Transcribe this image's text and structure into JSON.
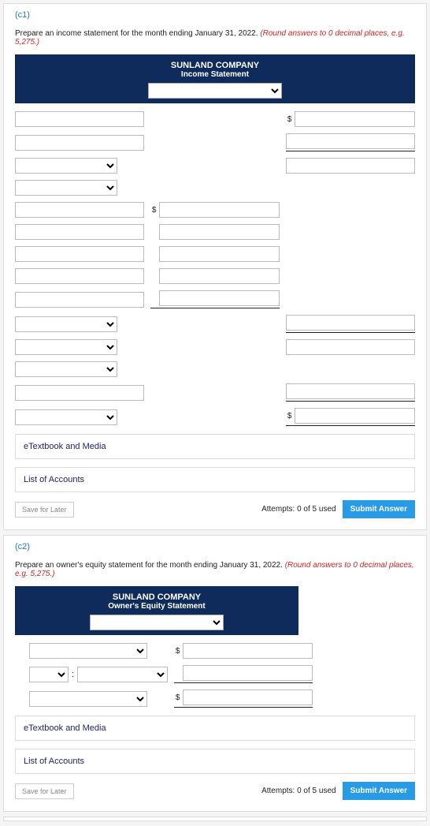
{
  "c1": {
    "label": "(c1)",
    "instruction": "Prepare an income statement for the month ending January 31, 2022. ",
    "instruction_red": "(Round answers to 0 decimal places, e.g. 5,275.)",
    "header_company": "SUNLAND COMPANY",
    "header_title": "Income Statement",
    "currency": "$",
    "etext": "eTextbook and Media",
    "list_accounts": "List of Accounts",
    "save": "Save for Later",
    "attempts": "Attempts: 0 of 5 used",
    "submit": "Submit Answer"
  },
  "c2": {
    "label": "(c2)",
    "instruction": "Prepare an owner's equity statement for the month ending January 31, 2022. ",
    "instruction_red": "(Round answers to 0 decimal places, e.g. 5,275.)",
    "header_company": "SUNLAND COMPANY",
    "header_title": "Owner's Equity Statement",
    "currency": "$",
    "colon": ":",
    "etext": "eTextbook and Media",
    "list_accounts": "List of Accounts",
    "save": "Save for Later",
    "attempts": "Attempts: 0 of 5 used",
    "submit": "Submit Answer"
  }
}
